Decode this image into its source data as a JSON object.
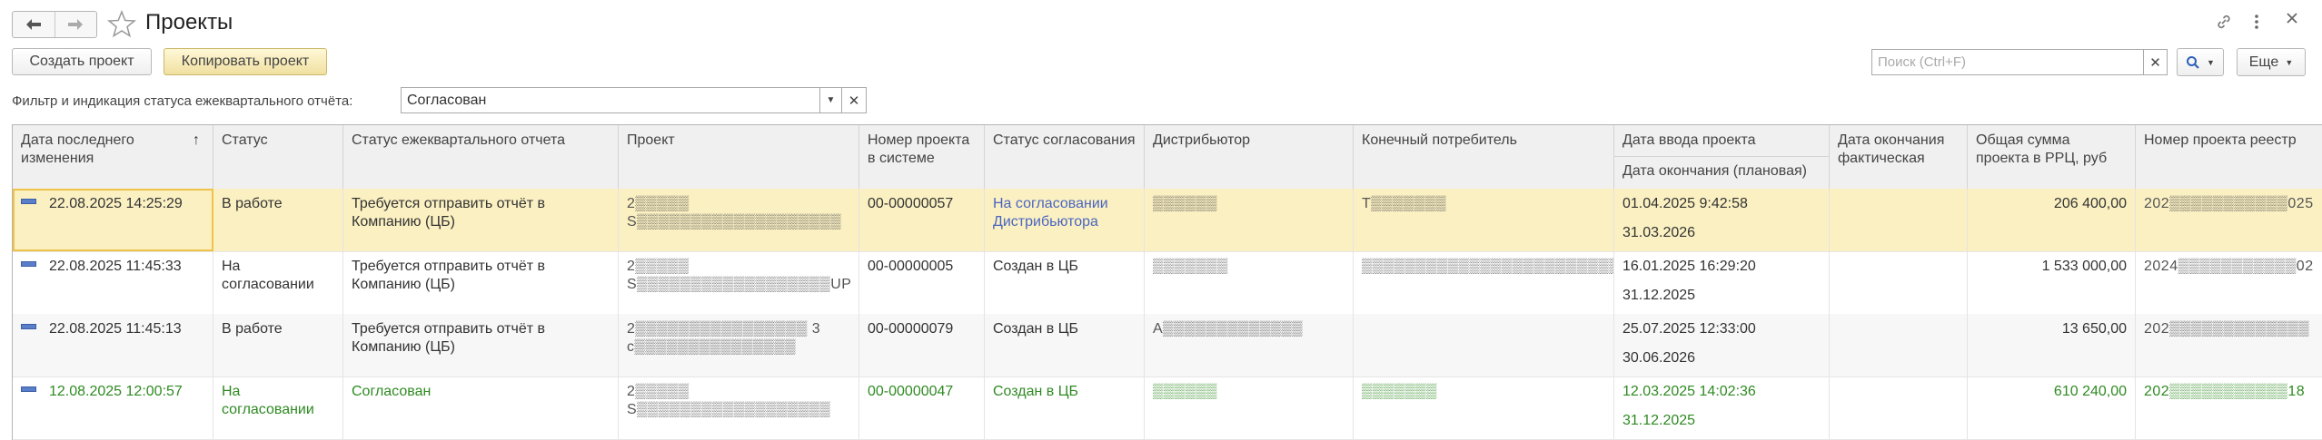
{
  "window": {
    "title": "Проекты"
  },
  "toolbar": {
    "create_label": "Создать проект",
    "copy_label": "Копировать проект",
    "search_placeholder": "Поиск (Ctrl+F)",
    "more_label": "Еще"
  },
  "icons": {
    "back": "arrow-left-icon",
    "forward": "arrow-right-icon",
    "star": "star-icon",
    "link": "link-icon",
    "menu": "kebab-menu-icon",
    "search": "search-icon"
  },
  "filter": {
    "label": "Фильтр и индикация статуса ежеквартального отчёта:",
    "value": "Согласован"
  },
  "table": {
    "columns": {
      "date_changed": "Дата последнего изменения",
      "status": "Статус",
      "quarterly": "Статус ежеквартального отчета",
      "project": "Проект",
      "system_no": "Номер проекта в системе",
      "approval": "Статус согласования",
      "distributor": "Дистрибьютор",
      "consumer": "Конечный потребитель",
      "date_entry": "Дата ввода проекта",
      "date_end_plan": "Дата окончания (плановая)",
      "date_end_fact": "Дата окончания фактическая",
      "total": "Общая сумма проекта в РРЦ, руб",
      "registry_no": "Номер проекта реестр"
    },
    "rows": [
      {
        "date_changed": "22.08.2025 14:25:29",
        "status": "В работе",
        "quarterly": "Требуется отправить отчёт в Компанию (ЦБ)",
        "project_l1": "2▒▒▒▒▒",
        "project_l2": "S▒▒▒▒▒▒▒▒▒▒▒▒▒▒▒▒▒▒▒",
        "system_no": "00-00000057",
        "approval": "На согласовании Дистрибьютора",
        "distributor": "▒▒▒▒▒▒",
        "consumer": "T▒▒▒▒▒▒▒",
        "date_entry": "01.04.2025 9:42:58",
        "date_end_plan": "31.03.2026",
        "date_end_fact": "",
        "total": "206 400,00",
        "registry_no": "202▒▒▒▒▒▒▒▒▒▒▒025"
      },
      {
        "date_changed": "22.08.2025 11:45:33",
        "status": "На согласовании",
        "quarterly": "Требуется отправить отчёт в Компанию (ЦБ)",
        "project_l1": "2▒▒▒▒▒",
        "project_l2": "S▒▒▒▒▒▒▒▒▒▒▒▒▒▒▒▒▒▒UP",
        "system_no": "00-00000005",
        "approval": "Создан в ЦБ",
        "distributor": "▒▒▒▒▒▒▒",
        "consumer": "▒▒▒▒▒▒▒▒▒▒▒▒▒▒▒▒▒▒▒▒▒▒▒▒▒\"",
        "date_entry": "16.01.2025 16:29:20",
        "date_end_plan": "31.12.2025",
        "date_end_fact": "",
        "total": "1 533 000,00",
        "registry_no": "2024▒▒▒▒▒▒▒▒▒▒▒02"
      },
      {
        "date_changed": "22.08.2025 11:45:13",
        "status": "В работе",
        "quarterly": "Требуется отправить отчёт в Компанию (ЦБ)",
        "project_l1": "2▒▒▒▒▒▒▒▒▒▒▒▒▒▒▒▒ 3",
        "project_l2": "c▒▒▒▒▒▒▒▒▒▒▒▒▒▒▒",
        "system_no": "00-00000079",
        "approval": "Создан в ЦБ",
        "distributor": "A▒▒▒▒▒▒▒▒▒▒▒▒▒",
        "consumer": "",
        "date_entry": "25.07.2025 12:33:00",
        "date_end_plan": "30.06.2026",
        "date_end_fact": "",
        "total": "13 650,00",
        "registry_no": "202▒▒▒▒▒▒▒▒▒▒▒▒▒"
      },
      {
        "date_changed": "12.08.2025 12:00:57",
        "status": "На согласовании",
        "quarterly": "Согласован",
        "project_l1": "2▒▒▒▒▒",
        "project_l2": "S▒▒▒▒▒▒▒▒▒▒▒▒▒▒▒▒▒▒",
        "system_no": "00-00000047",
        "approval": "Создан в ЦБ",
        "distributor": "▒▒▒▒▒▒",
        "consumer": "▒▒▒▒▒▒▒",
        "date_entry": "12.03.2025 14:02:36",
        "date_end_plan": "31.12.2025",
        "date_end_fact": "",
        "total": "610 240,00",
        "registry_no": "202▒▒▒▒▒▒▒▒▒▒▒18"
      }
    ]
  }
}
